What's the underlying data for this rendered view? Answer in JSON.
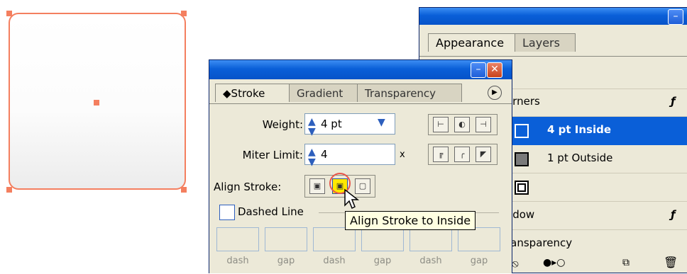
{
  "stroke_panel": {
    "tabs": [
      "Stroke",
      "Gradient",
      "Transparency"
    ],
    "weight_label": "Weight:",
    "weight_value": "4 pt",
    "miter_label": "Miter Limit:",
    "miter_value": "4",
    "miter_unit": "x",
    "align_label": "Align Stroke:",
    "dashed_label": "Dashed Line",
    "dash_labels": [
      "dash",
      "gap",
      "dash",
      "gap",
      "dash",
      "gap"
    ],
    "tooltip": "Align Stroke to Inside"
  },
  "appearance_panel": {
    "tabs": [
      "Appearance",
      "Layers"
    ],
    "rows": {
      "corners": "orners",
      "stroke1": "4 pt Inside",
      "stroke2": "1 pt Outside",
      "shadow": "adow",
      "transparency": "ransparency"
    }
  },
  "colors": {
    "selection": "#f47f5f",
    "title_blue": "#0a5fd8",
    "highlight": "#0a5fd8"
  }
}
